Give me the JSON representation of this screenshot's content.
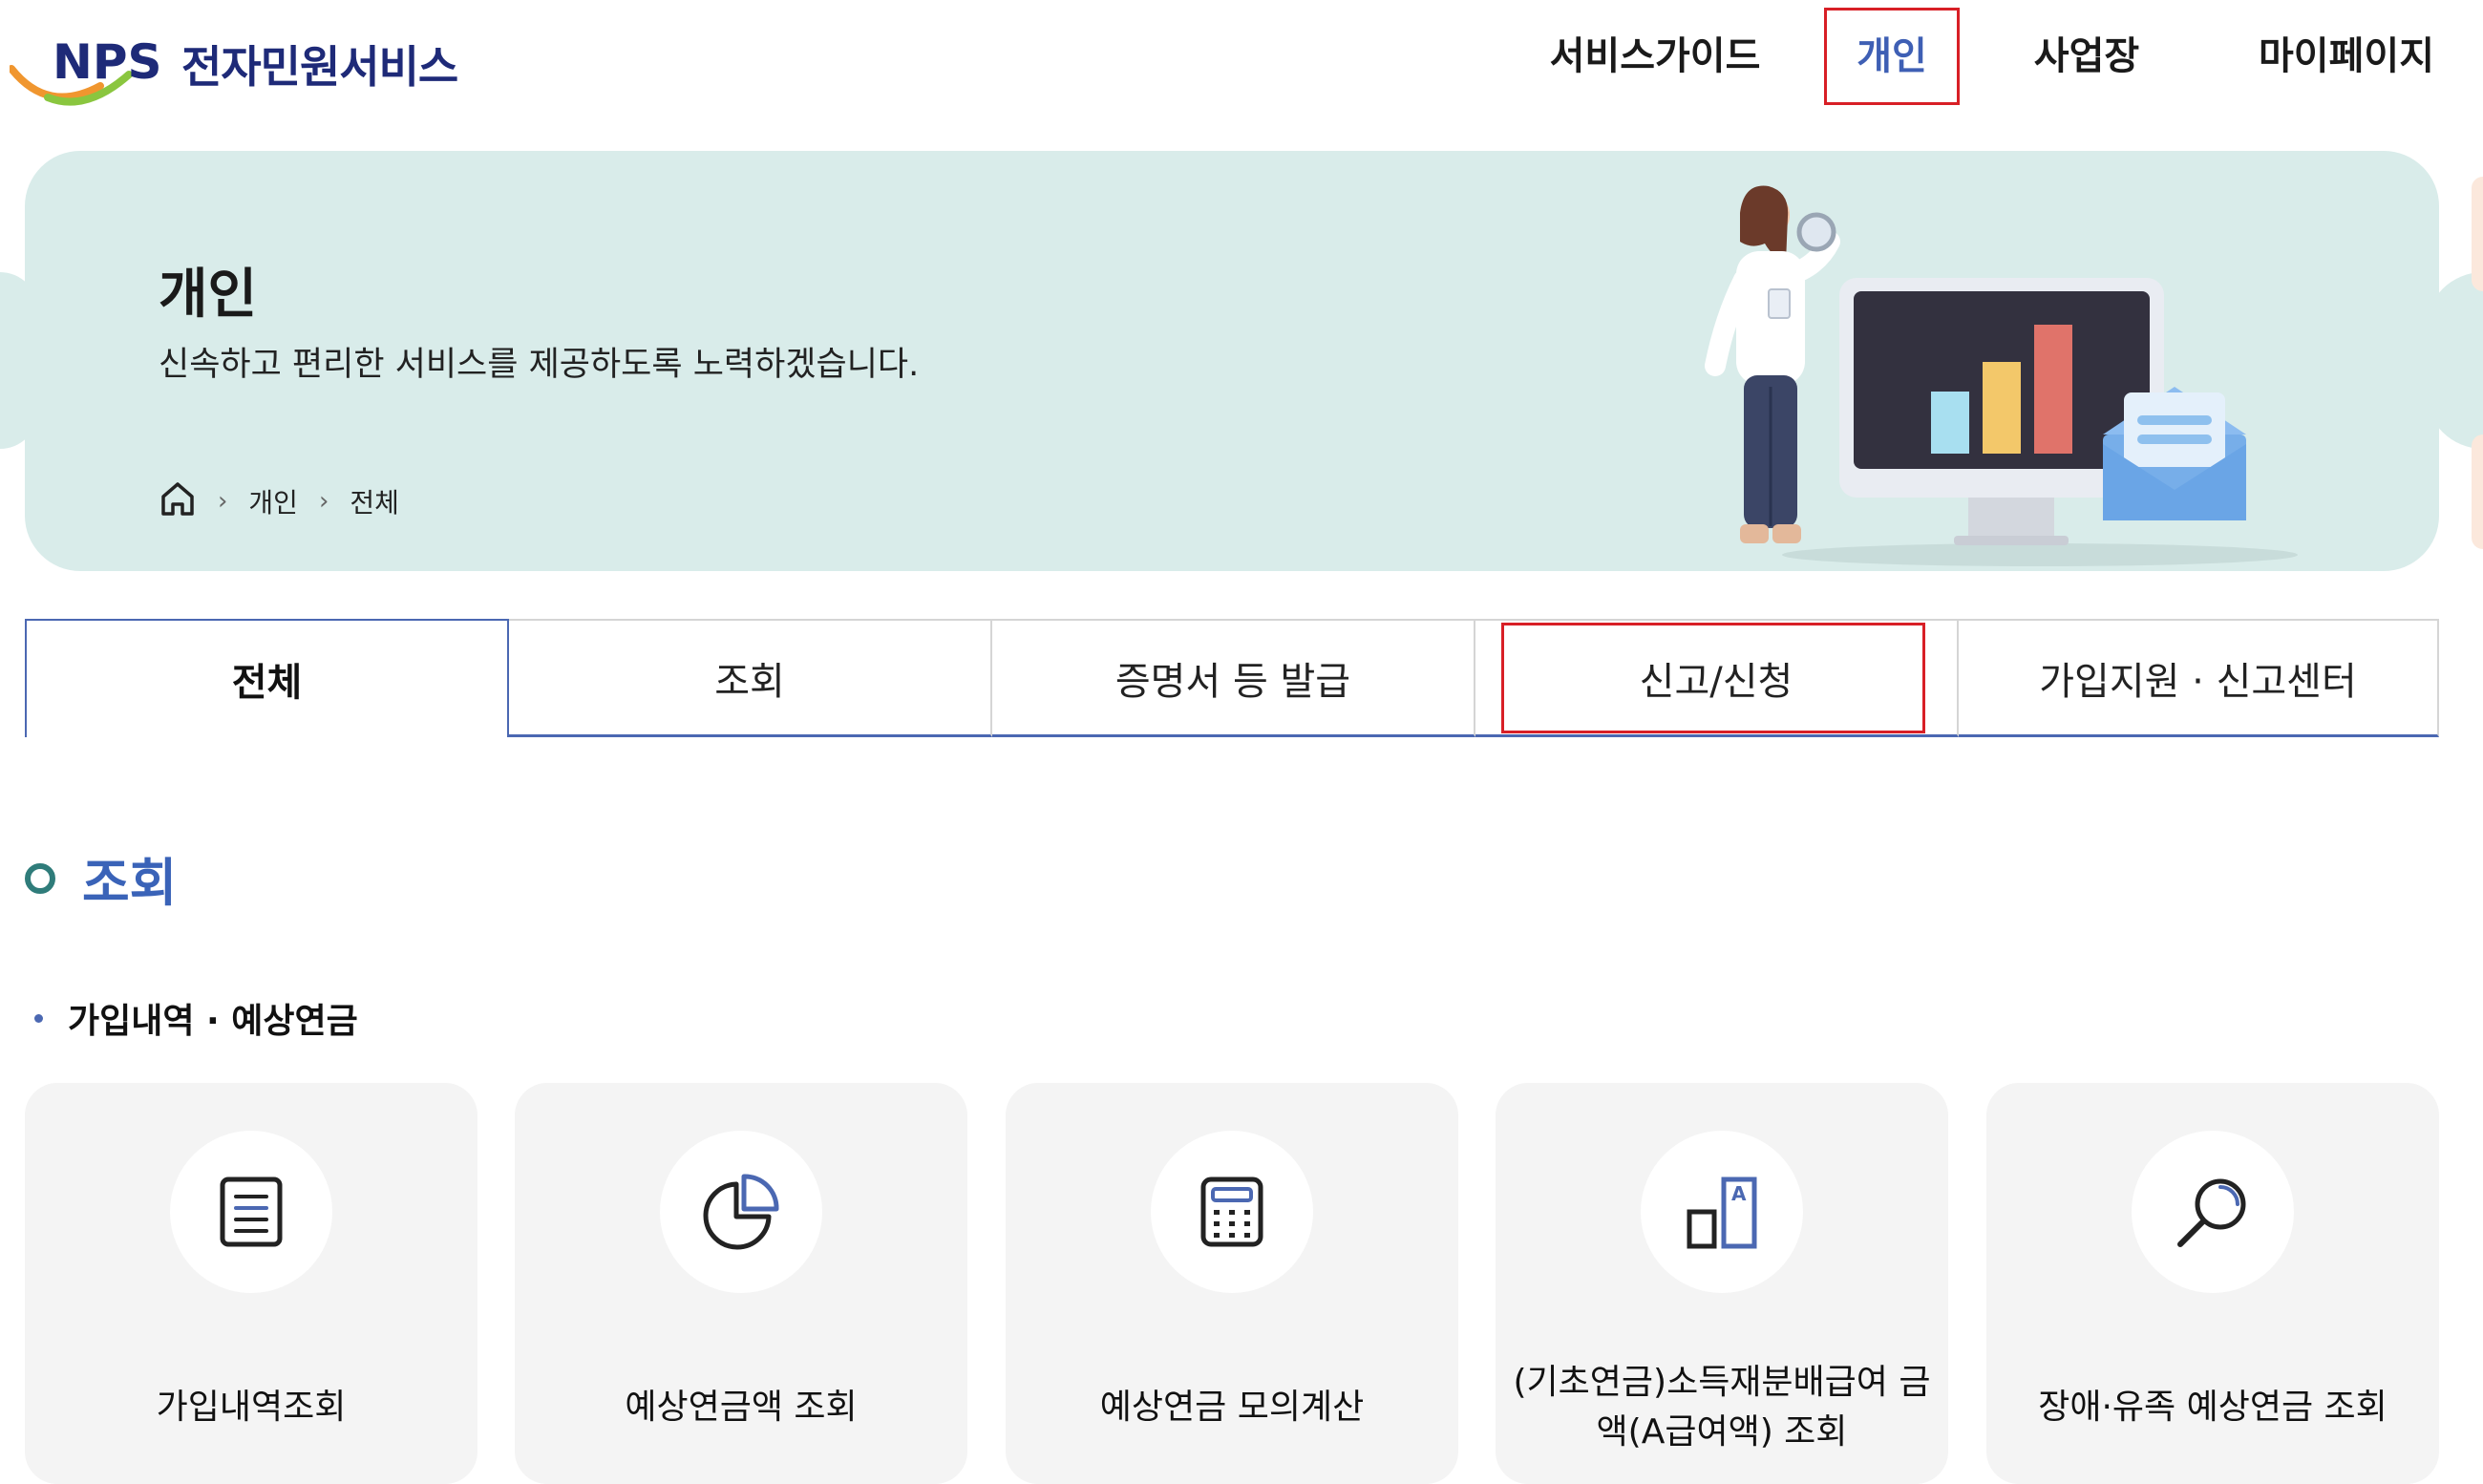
{
  "header": {
    "logo_text": "NPS 전자민원서비스",
    "nav": [
      {
        "label": "서비스가이드",
        "active": false
      },
      {
        "label": "개인",
        "active": true
      },
      {
        "label": "사업장",
        "active": false
      },
      {
        "label": "마이페이지",
        "active": false
      }
    ]
  },
  "hero": {
    "title": "개인",
    "subtitle": "신속하고 편리한 서비스를 제공하도록 노력하겠습니다.",
    "breadcrumb": [
      "개인",
      "전체"
    ],
    "home_icon": "home-icon"
  },
  "tabs": [
    {
      "label": "전체",
      "selected": true
    },
    {
      "label": "조회",
      "selected": false
    },
    {
      "label": "증명서 등 발급",
      "selected": false
    },
    {
      "label": "신고/신청",
      "selected": false
    },
    {
      "label": "가입지원 · 신고센터",
      "selected": false
    }
  ],
  "section": {
    "title": "조회",
    "subsection": "가입내역 · 예상연금"
  },
  "cards": [
    {
      "label": "가입내역조회",
      "icon": "document-icon"
    },
    {
      "label": "예상연금액 조회",
      "icon": "pie-chart-icon"
    },
    {
      "label": "예상연금 모의계산",
      "icon": "calculator-icon"
    },
    {
      "label": "(기초연금)소득재분배급여 금액(A급여액) 조회",
      "icon": "text-size-icon"
    },
    {
      "label": "장애·유족 예상연금 조회",
      "icon": "search-icon"
    }
  ],
  "colors": {
    "brand_navy": "#1e2a78",
    "accent_blue": "#3e5fb4",
    "highlight_red": "#d81f26",
    "hero_bg": "#d9ecea",
    "ring_teal": "#2f7c7a"
  }
}
